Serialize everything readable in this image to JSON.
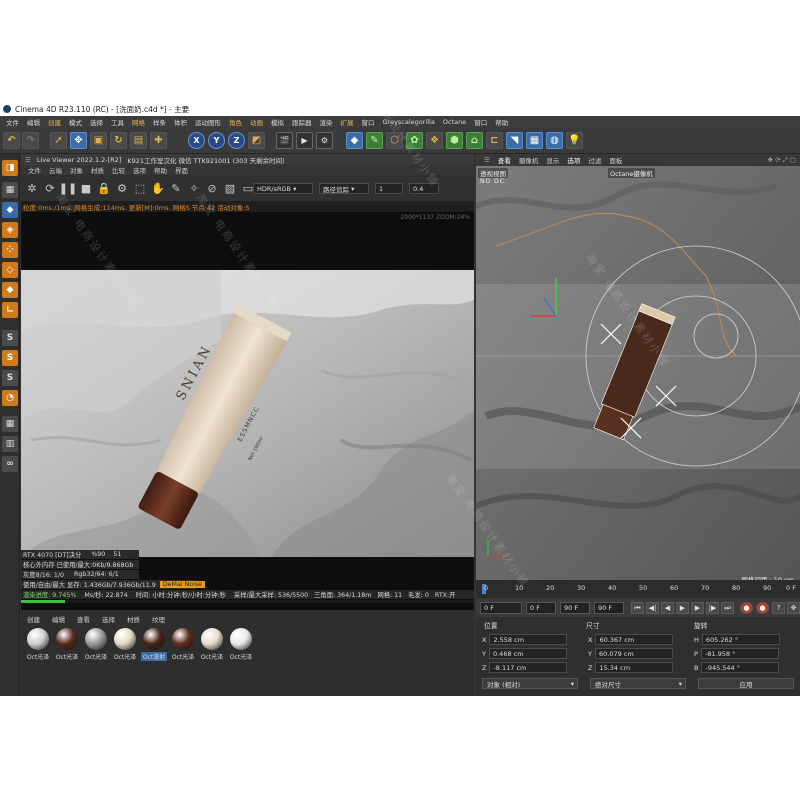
{
  "window": {
    "title": "Cinema 4D R23.110 (RC) - [洗面奶.c4d *] - 主要"
  },
  "menu": [
    "文件",
    "编辑",
    "创建",
    "模式",
    "选择",
    "工具",
    "网格",
    "样条",
    "体积",
    "运动图形",
    "角色",
    "动画",
    "模拟",
    "跟踪器",
    "渲染",
    "扩展",
    "窗口",
    "Greyscalegorilla",
    "Octane",
    "窗口",
    "帮助"
  ],
  "live_viewer": {
    "title": "Live Viewer 2022.1.2-[R2]",
    "title_extra": "K921工作室汉化  微信  TTK921001 (303 天剩余时间)",
    "menu": [
      "文件",
      "云端",
      "对象",
      "材质",
      "比较",
      "选项",
      "帮助",
      "界面"
    ],
    "color_mode": "HDR/sRGB",
    "kernel": "路径追踪",
    "spin1": "1",
    "spin2": "0.4",
    "status": "粒度:0ms./1ms. 网格生成:114ms. 更新[M]:0ms. 网格S 节点:42 活动对象:5",
    "resolution_hint": "2000*1137  ZOOM:24%",
    "product_brand": "SNIAN",
    "product_sub": "ESSMNCC",
    "product_small": "Net 100ml",
    "info": {
      "gpu": "RTX 4070 [DT]决分",
      "gpu_pct": "%90",
      "gpu_val": "51",
      "memory": "核心外内存 已使用/最大:0Kb/9.868Gb",
      "grey": "灰度8/16: 1/0",
      "rgb": "Rgb32/64: 6/1",
      "usage": "使用/自由/最大 显存: 1.436Gb/7.936Gb/11.9",
      "denoise": "DeMai Noise",
      "progress": "渲染进度: 9.745%",
      "ms": "Ms/秒: 22.874",
      "time": "时间: 小时:分钟:秒/小时:分钟:秒",
      "spp": "采样/最大采样: 536/5500",
      "tris": "三角面: 364/1.18m",
      "mesh": "网格: 11",
      "hair": "毛发: 0",
      "rtx": "RTX:开"
    },
    "progress_fraction": 0.097
  },
  "material_manager": {
    "tabs": [
      "创建",
      "编辑",
      "查看",
      "选择",
      "材质",
      "纹理"
    ],
    "materials": [
      {
        "label": "Oct光泽",
        "color": "#cfcfcf"
      },
      {
        "label": "Oct光泽",
        "color": "#5a2a1c"
      },
      {
        "label": "Oct光泽",
        "color": "#999999"
      },
      {
        "label": "Oct光泽",
        "color": "#e4d7c2"
      },
      {
        "label": "Oct漫射",
        "color": "#4a2418"
      },
      {
        "label": "Oct光泽",
        "color": "#5f2c1c"
      },
      {
        "label": "Oct光泽",
        "color": "#e6dccb"
      },
      {
        "label": "Oct光泽",
        "color": "#e9e9e9"
      }
    ]
  },
  "viewport": {
    "tabs": [
      "查看",
      "摄像机",
      "显示",
      "选项",
      "过滤",
      "面板"
    ],
    "view_name": "透视视图",
    "view_mode": "NO DC",
    "camera": "Octane摄像机",
    "grid_info": "网格间距 : 10 cm"
  },
  "timeline": {
    "ticks": [
      "0",
      "10",
      "20",
      "30",
      "40",
      "50",
      "60",
      "70",
      "80",
      "90"
    ],
    "end": "0 F"
  },
  "playback": {
    "current": "0 F",
    "start": "0 F",
    "end": "90 F",
    "end2": "90 F"
  },
  "coords": {
    "headers": [
      "位置",
      "尺寸",
      "旋转"
    ],
    "rows": [
      {
        "axis": "X",
        "pos": "2.558 cm",
        "size": "60.367 cm",
        "rot_axis": "H",
        "rot": "605.262 °"
      },
      {
        "axis": "Y",
        "pos": "0.468 cm",
        "size": "60.079 cm",
        "rot_axis": "P",
        "rot": "-81.958 °"
      },
      {
        "axis": "Z",
        "pos": "-8.117 cm",
        "size": "15.34 cm",
        "rot_axis": "B",
        "rot": "-945.544 °"
      }
    ],
    "mode": "对象 (相对)",
    "size_mode": "绝对尺寸",
    "apply": "应用"
  },
  "watermark": "淘宝 电商设计素材小铺"
}
